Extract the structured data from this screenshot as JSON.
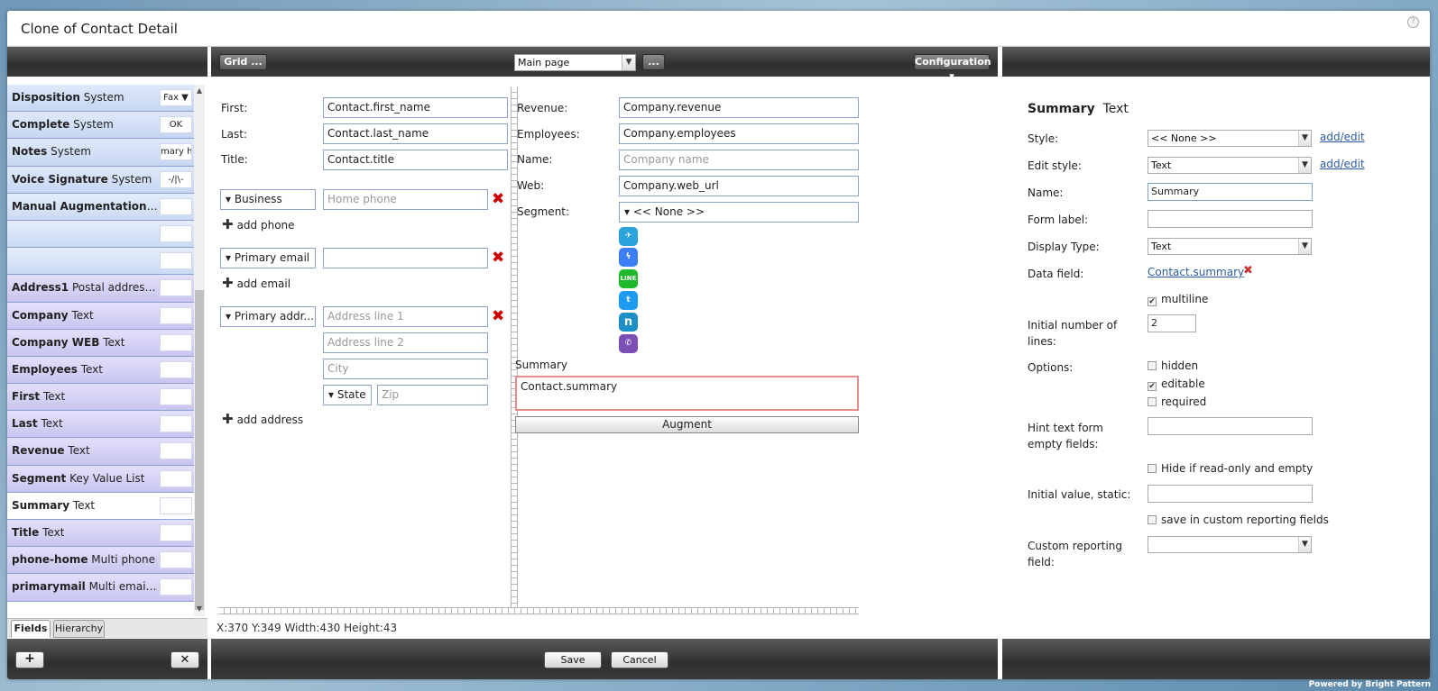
{
  "window": {
    "title": "Clone of Contact Detail"
  },
  "left": {
    "fields": [
      {
        "name": "Disposition",
        "type": "System",
        "kind": "sys",
        "preview": "Fax ▼"
      },
      {
        "name": "Complete",
        "type": "System",
        "kind": "sys",
        "preview": "OK"
      },
      {
        "name": "Notes",
        "type": "System",
        "kind": "sys",
        "preview": "mary had a little lamb"
      },
      {
        "name": "Voice Signature",
        "type": "System",
        "kind": "sys",
        "preview": "-/|\\-"
      },
      {
        "name": "Manual Augmentation Sys...",
        "type": "",
        "kind": "blank",
        "preview": ""
      },
      {
        "name": "",
        "type": "",
        "kind": "blank",
        "preview": ""
      },
      {
        "name": "",
        "type": "",
        "kind": "blank",
        "preview": ""
      },
      {
        "name": "Address1",
        "type": "Postal addresses",
        "kind": "user",
        "preview": ""
      },
      {
        "name": "Company",
        "type": "Text",
        "kind": "user",
        "preview": ""
      },
      {
        "name": "Company WEB",
        "type": "Text",
        "kind": "user",
        "preview": ""
      },
      {
        "name": "Employees",
        "type": "Text",
        "kind": "user",
        "preview": ""
      },
      {
        "name": "First",
        "type": "Text",
        "kind": "user",
        "preview": ""
      },
      {
        "name": "Last",
        "type": "Text",
        "kind": "user",
        "preview": ""
      },
      {
        "name": "Revenue",
        "type": "Text",
        "kind": "user",
        "preview": ""
      },
      {
        "name": "Segment",
        "type": "Key Value List",
        "kind": "user",
        "preview": ""
      },
      {
        "name": "Summary",
        "type": "Text",
        "kind": "selected",
        "preview": ""
      },
      {
        "name": "Title",
        "type": "Text",
        "kind": "user",
        "preview": ""
      },
      {
        "name": "phone-home",
        "type": "Multi phone",
        "kind": "user",
        "preview": ""
      },
      {
        "name": "primarymail",
        "type": "Multi email a...",
        "kind": "user",
        "preview": ""
      }
    ],
    "tabs": {
      "fields": "Fields",
      "hierarchy": "Hierarchy"
    },
    "add_label": "+",
    "delete_label": "✕"
  },
  "center": {
    "grid_label": "Grid ...",
    "page_select": "Main page",
    "more_label": "...",
    "config_label": "Configuration",
    "labels": {
      "first": "First:",
      "last": "Last:",
      "title": "Title:",
      "revenue": "Revenue:",
      "employees": "Employees:",
      "name": "Name:",
      "web": "Web:",
      "segment": "Segment:",
      "summary": "Summary"
    },
    "values": {
      "first": "Contact.first_name",
      "last": "Contact.last_name",
      "title": "Contact.title",
      "revenue": "Company.revenue",
      "employees": "Company.employees",
      "name_ph": "Company name",
      "web": "Company.web_url",
      "segment": "<< None >>",
      "summary": "Contact.summary"
    },
    "phone": {
      "type": "Business",
      "placeholder": "Home phone",
      "add": "add phone"
    },
    "email": {
      "type": "Primary email",
      "placeholder": "",
      "add": "add email"
    },
    "address": {
      "type": "Primary addr...",
      "line1": "Address line 1",
      "line2": "Address line 2",
      "city": "City",
      "state": "State",
      "zip": "Zip",
      "add": "add address"
    },
    "augment": "Augment",
    "status": "X:370 Y:349 Width:430 Height:43",
    "save": "Save",
    "cancel": "Cancel",
    "social_icons": [
      "telegram-icon",
      "messenger-icon",
      "line-icon",
      "twitter-icon",
      "nextdoor-icon",
      "viber-icon"
    ]
  },
  "right": {
    "title_name": "Summary",
    "title_type": "Text",
    "style_label": "Style:",
    "style_value": "<< None >>",
    "style_link": "add/edit",
    "edit_style_label": "Edit style:",
    "edit_style_value": "Text",
    "edit_style_link": "add/edit",
    "name_label": "Name:",
    "name_value": "Summary",
    "form_label_label": "Form label:",
    "form_label_value": "",
    "display_type_label": "Display Type:",
    "display_type_value": "Text",
    "data_field_label": "Data field:",
    "data_field_value": "Contact.summary",
    "multiline": "multiline",
    "initial_lines_label": "Initial number of lines:",
    "initial_lines_value": "2",
    "options_label": "Options:",
    "hidden": "hidden",
    "editable": "editable",
    "required": "required",
    "hint_label": "Hint text form empty fields:",
    "hint_value": "",
    "hide_if": "Hide if read-only and empty",
    "initial_value_label": "Initial value, static:",
    "initial_value": "",
    "save_custom": "save in custom reporting fields",
    "custom_field_label": "Custom reporting field:",
    "custom_field_value": ""
  },
  "footer": {
    "powered": "Powered by Bright Pattern"
  }
}
